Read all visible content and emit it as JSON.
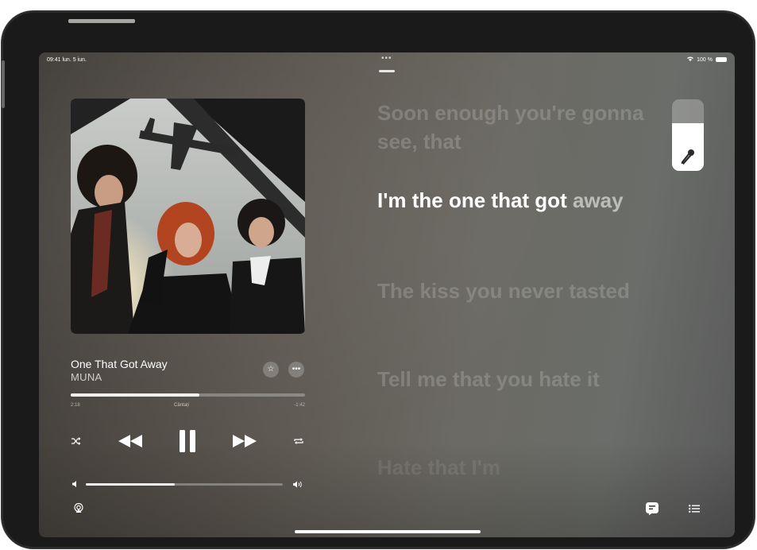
{
  "status": {
    "time": "09:41",
    "date": "lun. 5 iun.",
    "battery": "100 %"
  },
  "top": {
    "dots": "•••"
  },
  "track": {
    "title": "One That Got Away",
    "artist": "MUNA",
    "elapsed": "2:18",
    "remaining": "-1:42",
    "center_label": "Cântați",
    "progress": 0.55
  },
  "volume": {
    "level": 0.45
  },
  "vocal_slider": {
    "level": 0.67
  },
  "lyrics": [
    {
      "text": "Soon enough you're gonna see, that",
      "state": "dim"
    },
    {
      "sung": "I'm the one that got",
      "unsung": "away",
      "state": "active"
    },
    {
      "text": "The kiss you never tasted",
      "state": "dim"
    },
    {
      "text": "Tell me that you hate it",
      "state": "dim"
    },
    {
      "text": "Hate that I'm",
      "state": "fade"
    }
  ],
  "colors": {
    "accent": "#ffffff",
    "background": "#5b564f"
  },
  "icons": {
    "favorite": "star-icon",
    "more": "ellipsis-icon",
    "shuffle": "shuffle-icon",
    "previous": "rewind-icon",
    "play_pause": "pause-icon",
    "next": "fast-forward-icon",
    "repeat": "repeat-icon",
    "volume_low": "speaker-low-icon",
    "volume_high": "speaker-high-icon",
    "airplay": "airplay-icon",
    "lyrics": "lyrics-icon",
    "queue": "queue-list-icon",
    "mic": "microphone-icon"
  }
}
